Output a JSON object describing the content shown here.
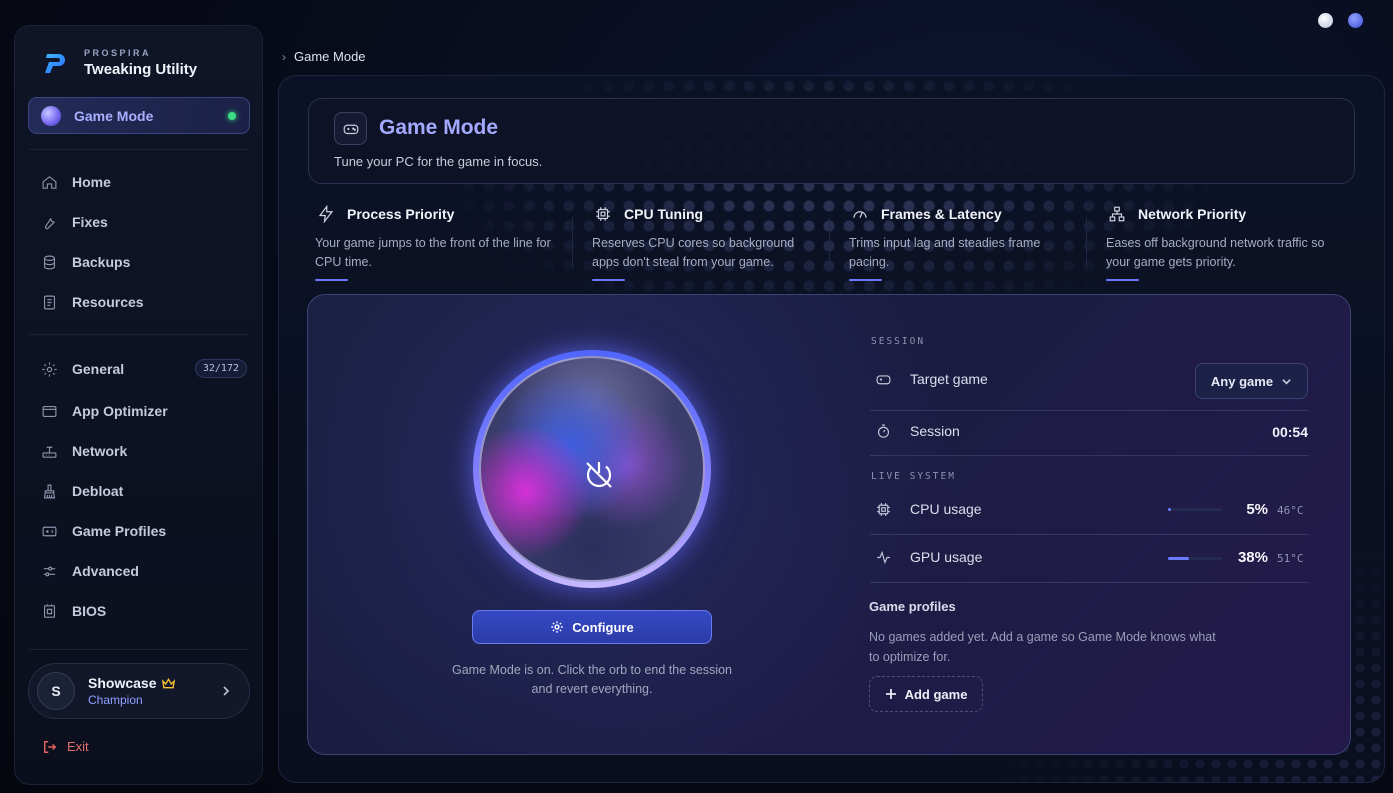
{
  "brand": {
    "small": "PROSPIRA",
    "title": "Tweaking Utility"
  },
  "sidebar": {
    "active_item": "Game Mode",
    "items_top": [
      {
        "label": "Home",
        "icon": "home-icon"
      },
      {
        "label": "Fixes",
        "icon": "wrench-icon"
      },
      {
        "label": "Backups",
        "icon": "database-icon"
      },
      {
        "label": "Resources",
        "icon": "document-icon"
      }
    ],
    "items_bottom": [
      {
        "label": "General",
        "icon": "gear-icon",
        "badge": "32/172"
      },
      {
        "label": "App Optimizer",
        "icon": "window-icon"
      },
      {
        "label": "Network",
        "icon": "network-icon"
      },
      {
        "label": "Debloat",
        "icon": "broom-icon"
      },
      {
        "label": "Game Profiles",
        "icon": "game-card-icon"
      },
      {
        "label": "Advanced",
        "icon": "sliders-icon"
      },
      {
        "label": "BIOS",
        "icon": "chip-icon"
      }
    ],
    "profile": {
      "initial": "S",
      "name": "Showcase",
      "rank": "Champion"
    },
    "exit_label": "Exit"
  },
  "breadcrumb": "Game Mode",
  "header": {
    "title": "Game Mode",
    "subtitle": "Tune your PC for the game in focus."
  },
  "features": [
    {
      "title": "Process Priority",
      "desc": "Your game jumps to the front of the line for CPU time.",
      "icon": "lightning-icon"
    },
    {
      "title": "CPU Tuning",
      "desc": "Reserves CPU cores so background apps don't steal from your game.",
      "icon": "cpu-icon"
    },
    {
      "title": "Frames & Latency",
      "desc": "Trims input lag and steadies frame pacing.",
      "icon": "gauge-icon"
    },
    {
      "title": "Network Priority",
      "desc": "Eases off background network traffic so your game gets priority.",
      "icon": "network-tree-icon"
    }
  ],
  "orb": {
    "configure_label": "Configure",
    "note": "Game Mode is on. Click the orb to end the session and revert everything."
  },
  "session": {
    "section_label": "SESSION",
    "target_label": "Target game",
    "target_value": "Any game",
    "session_label": "Session",
    "session_time": "00:54"
  },
  "live": {
    "section_label": "LIVE SYSTEM",
    "cpu_label": "CPU usage",
    "cpu_percent": "5%",
    "cpu_fraction": 0.05,
    "cpu_temp": "46°C",
    "gpu_label": "GPU usage",
    "gpu_percent": "38%",
    "gpu_fraction": 0.38,
    "gpu_temp": "51°C"
  },
  "game_profiles": {
    "title": "Game profiles",
    "desc": "No games added yet. Add a game so Game Mode knows what to optimize for.",
    "add_label": "Add game"
  },
  "colors": {
    "accent": "#6b7cff",
    "status_on": "#3ddc84",
    "exit": "#e07070"
  }
}
